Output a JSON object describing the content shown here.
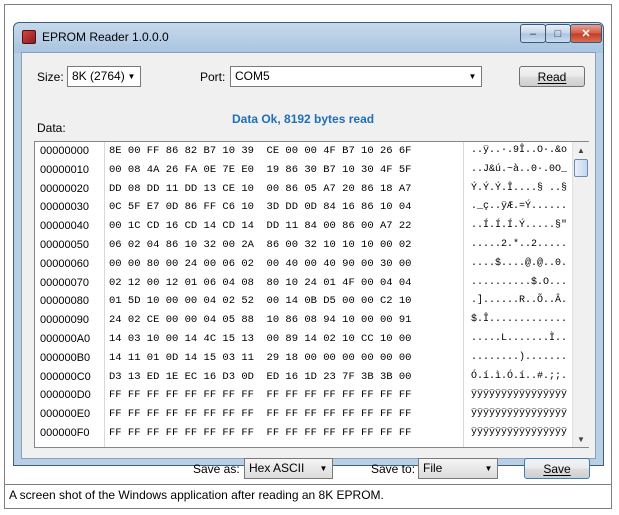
{
  "window": {
    "title": "EPROM Reader 1.0.0.0",
    "controls": {
      "minimize": "–",
      "maximize": "□",
      "close": "✕"
    }
  },
  "top": {
    "size_label": "Size:",
    "size_value": "8K (2764)",
    "port_label": "Port:",
    "port_value": "COM5",
    "read_button": "Read",
    "status": "Data Ok, 8192 bytes read",
    "data_label": "Data:"
  },
  "rows": [
    {
      "addr": "00000000",
      "hex": "8E 00 FF 86 82 B7 10 39  CE 00 00 4F B7 10 26 6F",
      "ascii": "..ÿ..·.9Î..O·.&o"
    },
    {
      "addr": "00000010",
      "hex": "00 08 4A 26 FA 0E 7E E0  19 86 30 B7 10 30 4F 5F",
      "ascii": "..J&ú.~à..0·.0O_"
    },
    {
      "addr": "00000020",
      "hex": "DD 08 DD 11 DD 13 CE 10  00 86 05 A7 20 86 18 A7",
      "ascii": "Ý.Ý.Ý.Î....§ ..§"
    },
    {
      "addr": "00000030",
      "hex": "0C 5F E7 0D 86 FF C6 10  3D DD 0D 84 16 86 10 04",
      "ascii": "._ç..ÿÆ.=Ý......"
    },
    {
      "addr": "00000040",
      "hex": "00 1C CD 16 CD 14 CD 14  DD 11 84 00 86 00 A7 22",
      "ascii": "..Í.Í.Í.Ý.....§\""
    },
    {
      "addr": "00000050",
      "hex": "06 02 04 86 10 32 00 2A  86 00 32 10 10 10 00 02",
      "ascii": ".....2.*..2....."
    },
    {
      "addr": "00000060",
      "hex": "00 00 80 00 24 00 06 02  00 40 00 40 90 00 30 00",
      "ascii": "....$....@.@..0."
    },
    {
      "addr": "00000070",
      "hex": "02 12 00 12 01 06 04 08  80 10 24 01 4F 00 04 04",
      "ascii": "..........$.O..."
    },
    {
      "addr": "00000080",
      "hex": "01 5D 10 00 00 04 02 52  00 14 0B D5 00 00 C2 10",
      "ascii": ".]......R..Õ..Â."
    },
    {
      "addr": "00000090",
      "hex": "24 02 CE 00 00 04 05 88  10 86 08 94 10 00 00 91",
      "ascii": "$.Î............."
    },
    {
      "addr": "000000A0",
      "hex": "14 03 10 00 14 4C 15 13  00 89 14 02 10 CC 10 00",
      "ascii": ".....L.......Ì.."
    },
    {
      "addr": "000000B0",
      "hex": "14 11 01 0D 14 15 03 11  29 18 00 00 00 00 00 00",
      "ascii": "........)......."
    },
    {
      "addr": "000000C0",
      "hex": "D3 13 ED 1E EC 16 D3 0D  ED 16 1D 23 7F 3B 3B 00",
      "ascii": "Ó.í.ì.Ó.í..#.;;."
    },
    {
      "addr": "000000D0",
      "hex": "FF FF FF FF FF FF FF FF  FF FF FF FF FF FF FF FF",
      "ascii": "ÿÿÿÿÿÿÿÿÿÿÿÿÿÿÿÿ"
    },
    {
      "addr": "000000E0",
      "hex": "FF FF FF FF FF FF FF FF  FF FF FF FF FF FF FF FF",
      "ascii": "ÿÿÿÿÿÿÿÿÿÿÿÿÿÿÿÿ"
    },
    {
      "addr": "000000F0",
      "hex": "FF FF FF FF FF FF FF FF  FF FF FF FF FF FF FF FF",
      "ascii": "ÿÿÿÿÿÿÿÿÿÿÿÿÿÿÿÿ"
    }
  ],
  "bottom": {
    "save_as_label": "Save as:",
    "save_as_value": "Hex ASCII",
    "save_to_label": "Save to:",
    "save_to_value": "File",
    "save_button": "Save"
  },
  "caption": "A screen shot of the Windows application after reading an 8K EPROM."
}
